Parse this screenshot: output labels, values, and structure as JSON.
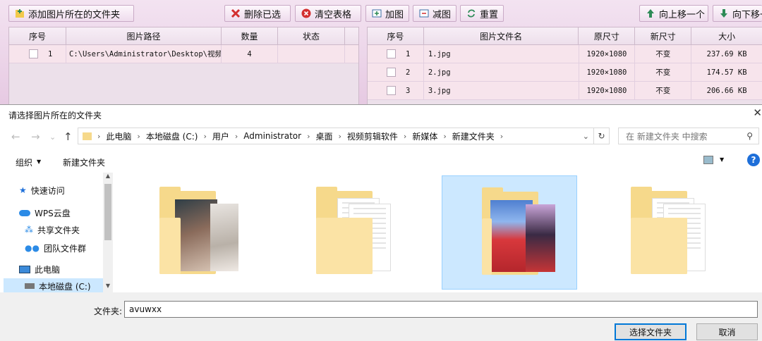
{
  "toolbar": {
    "add_folder": "添加图片所在的文件夹",
    "delete_selected": "删除已选",
    "clear_table": "清空表格",
    "add_image": "加图",
    "remove_image": "减图",
    "reset": "重置",
    "move_up": "向上移一个",
    "move_down": "向下移一"
  },
  "left_table": {
    "headers": [
      "序号",
      "图片路径",
      "数量",
      "状态"
    ],
    "rows": [
      {
        "index": "1",
        "path": "C:\\Users\\Administrator\\Desktop\\视频",
        "count": "4",
        "status": ""
      }
    ]
  },
  "right_table": {
    "headers": [
      "序号",
      "图片文件名",
      "原尺寸",
      "新尺寸",
      "大小"
    ],
    "rows": [
      {
        "index": "1",
        "name": "1.jpg",
        "orig": "1920×1080",
        "new": "不变",
        "size": "237.69 KB"
      },
      {
        "index": "2",
        "name": "2.jpg",
        "orig": "1920×1080",
        "new": "不变",
        "size": "174.57 KB"
      },
      {
        "index": "3",
        "name": "3.jpg",
        "orig": "1920×1080",
        "new": "不变",
        "size": "206.66 KB"
      }
    ]
  },
  "dialog": {
    "title": "请选择图片所在的文件夹",
    "breadcrumb": [
      "此电脑",
      "本地磁盘 (C:)",
      "用户",
      "Administrator",
      "桌面",
      "视频剪辑软件",
      "新媒体",
      "新建文件夹"
    ],
    "search_placeholder": "在 新建文件夹 中搜索",
    "organize": "组织",
    "new_folder": "新建文件夹",
    "nav": {
      "quick_access": "快速访问",
      "wps_cloud": "WPS云盘",
      "shared_folder": "共享文件夹",
      "team_folder": "团队文件群",
      "this_pc": "此电脑",
      "local_disk": "本地磁盘 (C:)"
    },
    "folder_label": "文件夹:",
    "folder_value": "avuwxx",
    "select_button": "选择文件夹",
    "cancel_button": "取消"
  },
  "colors": {
    "app_bg": "#e9cfe6",
    "selected_row": "#f7e4ec",
    "selected_folder": "#cce8ff",
    "folder_yellow": "#f6d98b",
    "help_blue": "#1e6fd9"
  },
  "icons": [
    "folder-add-icon",
    "delete-icon",
    "clear-icon",
    "add-image-icon",
    "remove-image-icon",
    "reset-icon",
    "up-arrow-icon",
    "down-arrow-icon",
    "back-arrow-icon",
    "forward-arrow-icon",
    "up-level-icon",
    "refresh-icon",
    "search-icon",
    "view-icon",
    "help-icon",
    "star-icon",
    "cloud-icon",
    "shared-icon",
    "team-icon",
    "computer-icon",
    "disk-icon"
  ]
}
